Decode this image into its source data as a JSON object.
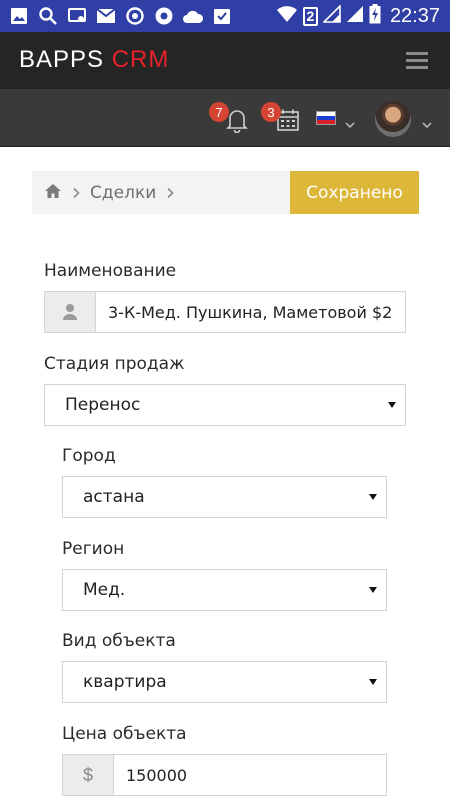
{
  "status_bar": {
    "time": "22:37",
    "sim_label": "2",
    "left_icons": [
      "gallery-icon",
      "search-icon",
      "cast-icon",
      "email-icon",
      "sync-icon",
      "chrome-icon",
      "cloud-icon",
      "clipboard-check-icon"
    ],
    "right_icons": [
      "wifi-icon",
      "sim-2-icon",
      "signal-icon",
      "signal-icon",
      "battery-charging-icon"
    ]
  },
  "app": {
    "brand_part1": "BAPPS",
    "brand_part2": "CRM",
    "brand_accent_color": "#e8212a"
  },
  "toolbar": {
    "notifications_count": "7",
    "calendar_count": "3",
    "language": "ru",
    "badge_color": "#d64533"
  },
  "breadcrumb": {
    "home_icon": "home-icon",
    "items": [
      "Сделки"
    ],
    "save_label": "Сохранено",
    "save_color": "#ddb73a"
  },
  "form": {
    "name_label": "Наименование",
    "name_value": "3-К-Мед. Пушкина, Маметовой $2",
    "stage_label": "Стадия продаж",
    "stage_value": "Перенос",
    "city_label": "Город",
    "city_value": "астана",
    "region_label": "Регион",
    "region_value": "Мед.",
    "object_type_label": "Вид объекта",
    "object_type_value": "квартира",
    "price_label": "Цена объекта",
    "price_addon": "$",
    "price_value": "150000"
  }
}
